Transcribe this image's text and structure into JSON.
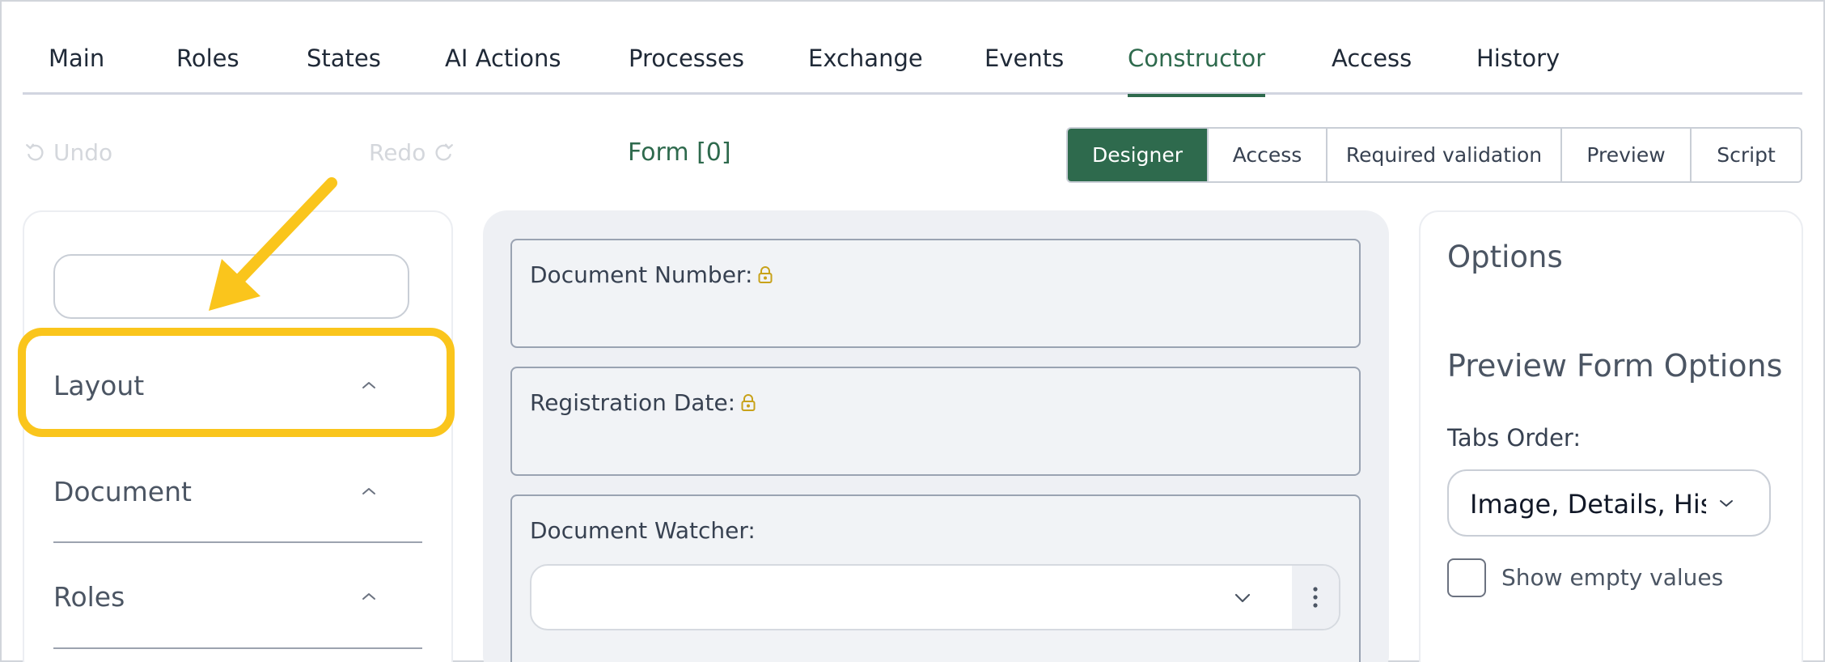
{
  "tabs": [
    {
      "label": "Main"
    },
    {
      "label": "Roles"
    },
    {
      "label": "States"
    },
    {
      "label": "AI Actions"
    },
    {
      "label": "Processes"
    },
    {
      "label": "Exchange"
    },
    {
      "label": "Events"
    },
    {
      "label": "Constructor",
      "active": true
    },
    {
      "label": "Access"
    },
    {
      "label": "History"
    }
  ],
  "toolbar": {
    "undo_label": "Undo",
    "redo_label": "Redo",
    "form_title": "Form [0]",
    "modes": [
      {
        "label": "Designer",
        "active": true
      },
      {
        "label": "Access"
      },
      {
        "label": "Required validation"
      },
      {
        "label": "Preview"
      },
      {
        "label": "Script"
      }
    ]
  },
  "left_panel": {
    "search_value": "",
    "sections": [
      {
        "label": "Layout",
        "highlighted": true
      },
      {
        "label": "Document"
      },
      {
        "label": "Roles"
      }
    ]
  },
  "canvas": {
    "fields": [
      {
        "label": "Document Number:",
        "locked": true
      },
      {
        "label": "Registration Date:",
        "locked": true
      },
      {
        "label": "Document Watcher:",
        "locked": false,
        "select_value": ""
      }
    ]
  },
  "options_panel": {
    "title": "Options",
    "preview_title": "Preview Form Options",
    "tabs_order_label": "Tabs Order:",
    "tabs_order_value": "Image, Details, History",
    "show_empty_label": "Show empty values",
    "show_empty_checked": false
  },
  "colors": {
    "accent": "#2e6a4d",
    "highlight": "#fac51c",
    "canvas_bg": "#eef0f4"
  }
}
